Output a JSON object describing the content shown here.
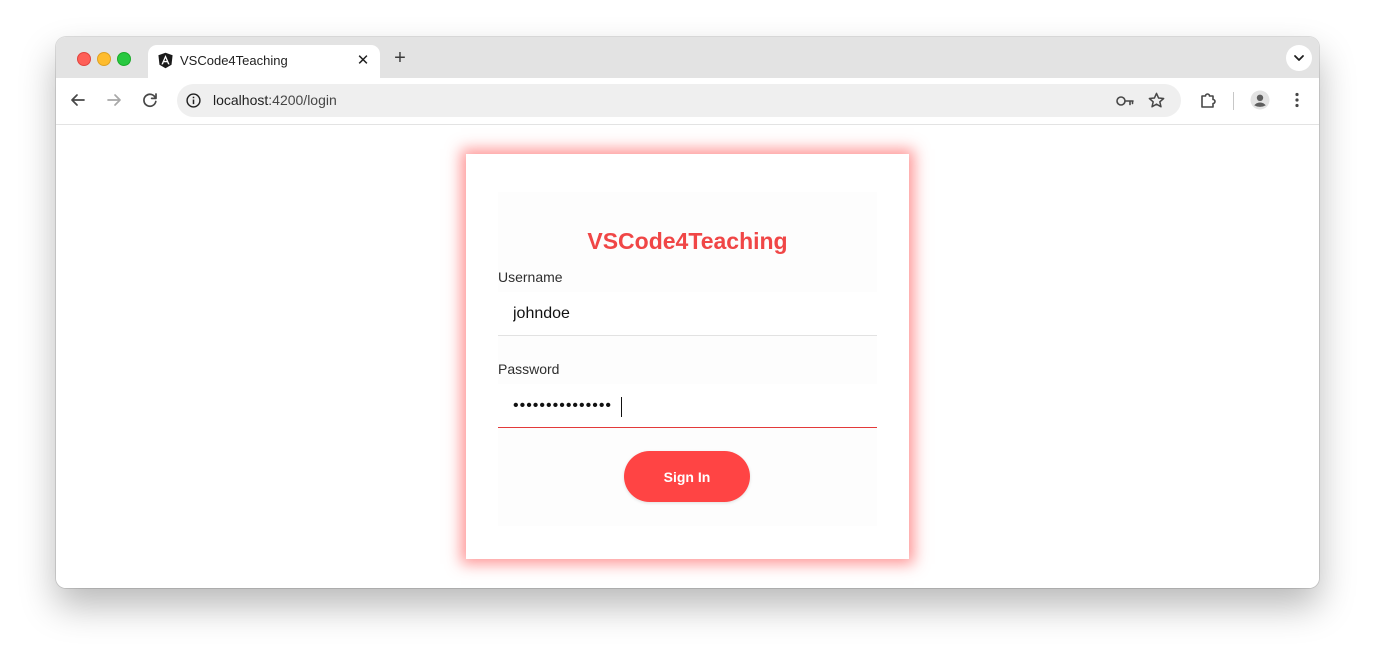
{
  "browser": {
    "tab": {
      "title": "VSCode4Teaching",
      "favicon": "angular-icon",
      "close_glyph": "✕"
    },
    "new_tab_glyph": "+",
    "address": {
      "host": "localhost",
      "path": ":4200/login"
    },
    "icons": [
      "back-arrow-icon",
      "forward-arrow-icon",
      "reload-icon",
      "site-info-icon",
      "key-icon",
      "star-icon",
      "extensions-icon",
      "profile-icon",
      "kebab-menu-icon",
      "chevron-down-icon"
    ]
  },
  "login": {
    "title": "VSCode4Teaching",
    "username_label": "Username",
    "username_value": "johndoe",
    "password_label": "Password",
    "password_value": "•••••••••••••••",
    "submit_label": "Sign In"
  },
  "colors": {
    "accent": "#ff4444",
    "title": "#f04646",
    "card_glow": "#ff4040"
  }
}
